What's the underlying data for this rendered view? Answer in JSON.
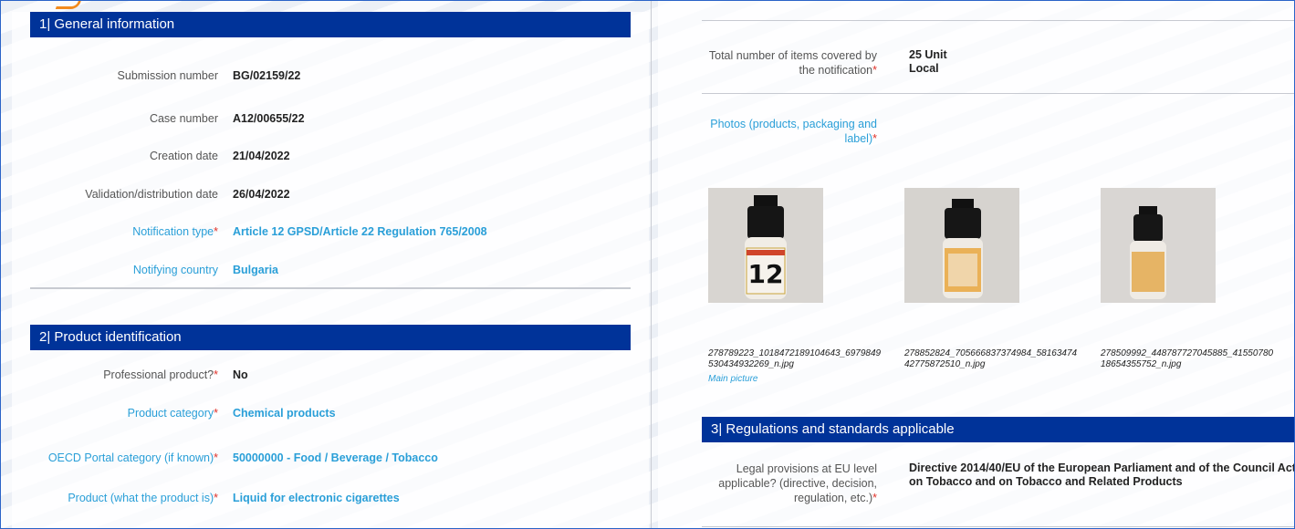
{
  "section1": {
    "title": "1| General information",
    "fields": [
      {
        "label": "Submission number",
        "value": "BG/02159/22"
      },
      {
        "label": "Case number",
        "value": "A12/00655/22"
      },
      {
        "label": "Creation date",
        "value": "21/04/2022"
      },
      {
        "label": "Validation/distribution date",
        "value": "26/04/2022"
      },
      {
        "label": "Notification type",
        "value": "Article 12 GPSD/Article 22 Regulation 765/2008"
      },
      {
        "label": "Notifying country",
        "value": "Bulgaria"
      }
    ]
  },
  "section2": {
    "title": "2| Product identification",
    "fields": [
      {
        "label": "Professional product?",
        "value": "No"
      },
      {
        "label": "Product category",
        "value": "Chemical products"
      },
      {
        "label": "OECD Portal category (if known)",
        "value": "50000000 - Food / Beverage / Tobacco"
      },
      {
        "label": "Product (what the product is)",
        "value": "Liquid for electronic cigarettes"
      }
    ]
  },
  "right": {
    "items_label_line1": "Total number of items covered by",
    "items_label_line2": "the notification",
    "items_value_line1": "25 Unit",
    "items_value_line2": "Local",
    "photos_label_line1": "Photos (products, packaging and",
    "photos_label_line2": "label)",
    "photos": [
      {
        "caption_line1": "278789223_1018472189104643_6979849",
        "caption_line2": "530434932269_n.jpg",
        "main_label": "Main picture",
        "bottle_text": "12"
      },
      {
        "caption_line1": "278852824_705666837374984_58163474",
        "caption_line2": "42775872510_n.jpg"
      },
      {
        "caption_line1": "278509992_448787727045885_41550780",
        "caption_line2": "18654355752_n.jpg"
      }
    ]
  },
  "section3": {
    "title": "3| Regulations and standards applicable",
    "legal_label_line1": "Legal provisions at EU level",
    "legal_label_line2": "applicable? (directive, decision,",
    "legal_label_line3": "regulation, etc.)",
    "legal_value_line1": "Directive 2014/40/EU of the European Parliament and of the Council Act",
    "legal_value_line2": "on Tobacco and on Tobacco and Related Products"
  },
  "required_marker": "*",
  "colors": {
    "header_bg": "#003399",
    "link_blue": "#2a9fd8",
    "required_red": "#e0332b",
    "accent_orange": "#f28a1c"
  }
}
